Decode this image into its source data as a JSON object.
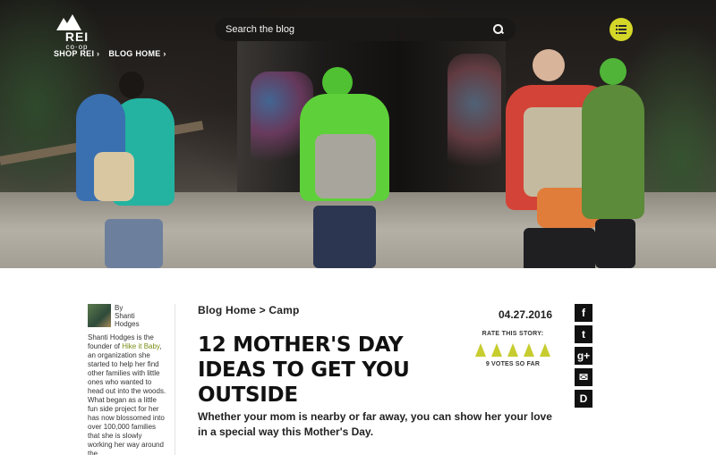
{
  "header": {
    "logo_text": "REI",
    "logo_sub": "co·op",
    "nav": [
      {
        "label": "SHOP REI ›"
      },
      {
        "label": "BLOG HOME ›"
      }
    ],
    "search_placeholder": "Search the blog"
  },
  "author": {
    "by_label": "By",
    "name_first": "Shanti",
    "name_last": "Hodges",
    "bio_pre": "Shanti Hodges is the founder of ",
    "bio_link": "Hike it Baby",
    "bio_post": ", an organization she started to help her find other families with little ones who wanted to head out into the woods. What began as a little fun side project for her has now blossomed into over 100,000 families that she is slowly working her way around the"
  },
  "article": {
    "breadcrumb": "Blog Home > Camp",
    "date": "04.27.2016",
    "title": "12 Mother's Day Ideas to Get You Outside",
    "rating_label": "RATE THIS STORY:",
    "votes": "9 VOTES SO FAR",
    "lede": "Whether your mom is nearby or far away, you can show her your love in a special way this Mother's Day."
  },
  "share": {
    "icons": [
      "facebook-icon",
      "twitter-icon",
      "google-plus-icon",
      "email-icon",
      "disqus-icon"
    ],
    "glyphs": [
      "f",
      "t",
      "g+",
      "✉",
      "D"
    ]
  },
  "colors": {
    "accent": "#d5d728",
    "rating": "#c7cc2f",
    "link": "#7a8d15"
  }
}
